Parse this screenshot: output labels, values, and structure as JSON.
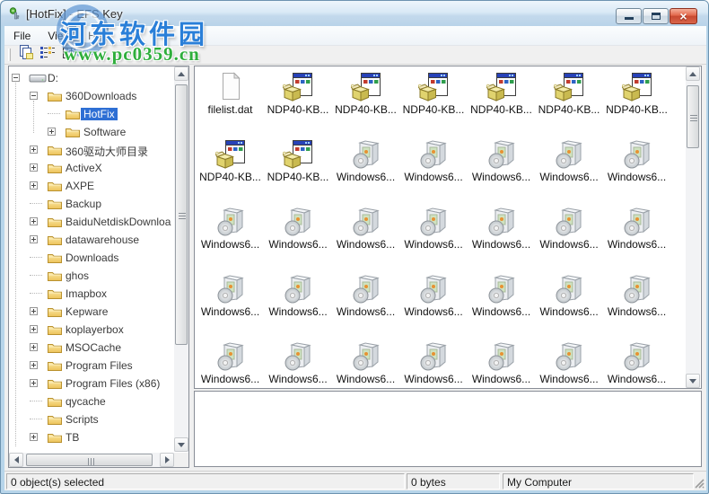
{
  "window": {
    "title": "[HotFix] - EFS Key",
    "controls": [
      "minimize",
      "maximize",
      "close"
    ]
  },
  "watermark": {
    "site_name": "河东软件园",
    "site_url": "www.pc0359.cn",
    "name_color": "#2a7fd8",
    "url_color": "#2fae3c"
  },
  "menu": [
    "File",
    "View",
    "Help"
  ],
  "toolbar": [
    {
      "name": "copy-button",
      "icon": "copy-pages-icon"
    },
    {
      "name": "list-view-button",
      "icon": "list-view-icon"
    },
    {
      "name": "details-view-button",
      "icon": "details-grid-icon"
    }
  ],
  "tree": [
    {
      "label": "D:",
      "level": 0,
      "expand": "minus",
      "icon": "drive",
      "selected": false
    },
    {
      "label": "360Downloads",
      "level": 1,
      "expand": "minus",
      "icon": "folder",
      "selected": false
    },
    {
      "label": "HotFix",
      "level": 2,
      "expand": "none",
      "icon": "folder",
      "selected": true
    },
    {
      "label": "Software",
      "level": 2,
      "expand": "plus",
      "icon": "folder",
      "selected": false
    },
    {
      "label": "360驱动大师目录",
      "level": 1,
      "expand": "plus",
      "icon": "folder",
      "selected": false
    },
    {
      "label": "ActiveX",
      "level": 1,
      "expand": "plus",
      "icon": "folder",
      "selected": false
    },
    {
      "label": "AXPE",
      "level": 1,
      "expand": "plus",
      "icon": "folder",
      "selected": false
    },
    {
      "label": "Backup",
      "level": 1,
      "expand": "none",
      "icon": "folder",
      "selected": false
    },
    {
      "label": "BaiduNetdiskDownloa",
      "level": 1,
      "expand": "plus",
      "icon": "folder",
      "selected": false
    },
    {
      "label": "datawarehouse",
      "level": 1,
      "expand": "plus",
      "icon": "folder",
      "selected": false
    },
    {
      "label": "Downloads",
      "level": 1,
      "expand": "none",
      "icon": "folder",
      "selected": false
    },
    {
      "label": "ghos",
      "level": 1,
      "expand": "none",
      "icon": "folder",
      "selected": false
    },
    {
      "label": "Imapbox",
      "level": 1,
      "expand": "none",
      "icon": "folder",
      "selected": false
    },
    {
      "label": "Kepware",
      "level": 1,
      "expand": "plus",
      "icon": "folder",
      "selected": false
    },
    {
      "label": "koplayerbox",
      "level": 1,
      "expand": "plus",
      "icon": "folder",
      "selected": false
    },
    {
      "label": "MSOCache",
      "level": 1,
      "expand": "plus",
      "icon": "folder",
      "selected": false
    },
    {
      "label": "Program Files",
      "level": 1,
      "expand": "plus",
      "icon": "folder",
      "selected": false
    },
    {
      "label": "Program Files (x86)",
      "level": 1,
      "expand": "plus",
      "icon": "folder",
      "selected": false
    },
    {
      "label": "qycache",
      "level": 1,
      "expand": "none",
      "icon": "folder",
      "selected": false
    },
    {
      "label": "Scripts",
      "level": 1,
      "expand": "none",
      "icon": "folder",
      "selected": false
    },
    {
      "label": "TB",
      "level": 1,
      "expand": "plus",
      "icon": "folder",
      "selected": false
    },
    {
      "label": "",
      "level": 1,
      "expand": "none",
      "icon": "folder",
      "selected": false
    }
  ],
  "files": [
    {
      "name": "filelist.dat",
      "icon": "document"
    },
    {
      "name": "NDP40-KB...",
      "icon": "installer"
    },
    {
      "name": "NDP40-KB...",
      "icon": "installer"
    },
    {
      "name": "NDP40-KB...",
      "icon": "installer"
    },
    {
      "name": "NDP40-KB...",
      "icon": "installer"
    },
    {
      "name": "NDP40-KB...",
      "icon": "installer"
    },
    {
      "name": "NDP40-KB...",
      "icon": "installer"
    },
    {
      "name": "NDP40-KB...",
      "icon": "installer"
    },
    {
      "name": "NDP40-KB...",
      "icon": "installer"
    },
    {
      "name": "Windows6...",
      "icon": "msu"
    },
    {
      "name": "Windows6...",
      "icon": "msu"
    },
    {
      "name": "Windows6...",
      "icon": "msu"
    },
    {
      "name": "Windows6...",
      "icon": "msu"
    },
    {
      "name": "Windows6...",
      "icon": "msu"
    },
    {
      "name": "Windows6...",
      "icon": "msu"
    },
    {
      "name": "Windows6...",
      "icon": "msu"
    },
    {
      "name": "Windows6...",
      "icon": "msu"
    },
    {
      "name": "Windows6...",
      "icon": "msu"
    },
    {
      "name": "Windows6...",
      "icon": "msu"
    },
    {
      "name": "Windows6...",
      "icon": "msu"
    },
    {
      "name": "Windows6...",
      "icon": "msu"
    },
    {
      "name": "Windows6...",
      "icon": "msu"
    },
    {
      "name": "Windows6...",
      "icon": "msu"
    },
    {
      "name": "Windows6...",
      "icon": "msu"
    },
    {
      "name": "Windows6...",
      "icon": "msu"
    },
    {
      "name": "Windows6...",
      "icon": "msu"
    },
    {
      "name": "Windows6...",
      "icon": "msu"
    },
    {
      "name": "Windows6...",
      "icon": "msu"
    },
    {
      "name": "Windows6...",
      "icon": "msu"
    },
    {
      "name": "Windows6...",
      "icon": "msu"
    },
    {
      "name": "Windows6...",
      "icon": "msu"
    },
    {
      "name": "Windows6...",
      "icon": "msu"
    },
    {
      "name": "Windows6...",
      "icon": "msu"
    },
    {
      "name": "Windows6...",
      "icon": "msu"
    },
    {
      "name": "Windows6...",
      "icon": "msu"
    }
  ],
  "status": {
    "objects": "0 object(s) selected",
    "bytes": "0 bytes",
    "location": "My Computer"
  }
}
